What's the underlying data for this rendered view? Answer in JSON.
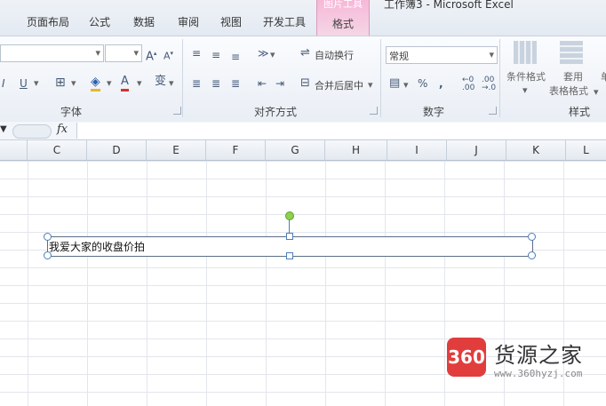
{
  "window": {
    "tabs": [
      "页面布局",
      "公式",
      "数据",
      "审阅",
      "视图",
      "开发工具"
    ],
    "contextual_tab_group": "图片工具",
    "contextual_tab": "格式",
    "doc_title": "工作簿3 - Microsoft Excel"
  },
  "ribbon": {
    "font_group_label": "字体",
    "align_group_label": "对齐方式",
    "number_group_label": "数字",
    "styles_group_label": "样式",
    "wrap_text": "自动换行",
    "merge_center": "合并后居中",
    "number_format": "常规",
    "conditional_format": "条件格式",
    "table_format_1": "套用",
    "table_format_2": "表格格式",
    "cell_styles_partial": "单",
    "icons": [
      "increase-font-icon",
      "decrease-font-icon",
      "italic-icon",
      "underline-icon",
      "border-icon",
      "fill-color-icon",
      "font-color-icon",
      "phonetic-icon",
      "align-top-icon",
      "align-middle-icon",
      "align-bottom-icon",
      "orientation-icon",
      "align-left-icon",
      "center-icon",
      "align-right-icon",
      "decrease-indent-icon",
      "increase-indent-icon",
      "currency-icon",
      "percent-icon",
      "comma-icon",
      "increase-decimal-icon",
      "decrease-decimal-icon"
    ]
  },
  "formula_bar": {
    "fx": "fx",
    "value": ""
  },
  "sheet": {
    "columns": [
      "C",
      "D",
      "E",
      "F",
      "G",
      "H",
      "I",
      "J",
      "K",
      "L"
    ]
  },
  "textbox": {
    "text": "我爱大家的收盘价拍"
  },
  "watermark": {
    "logo": "360",
    "name": "货源之家",
    "url": "www.360hyzj.com"
  }
}
